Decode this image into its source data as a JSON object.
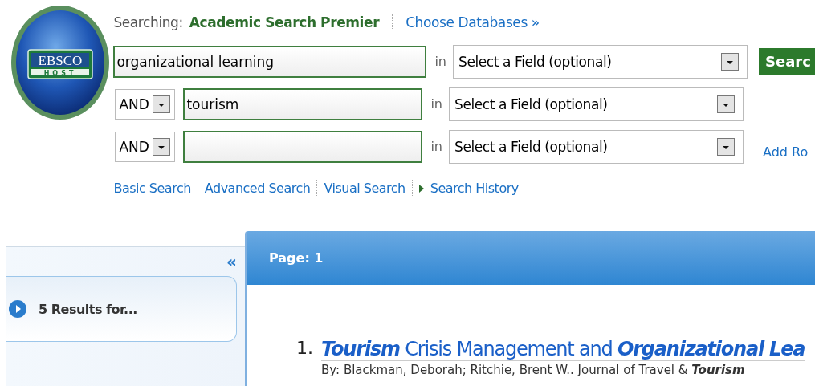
{
  "logo": {
    "top": "EBSCO",
    "bottom": "HOST"
  },
  "searching": {
    "label": "Searching:",
    "database": "Academic Search Premier",
    "choose_link": "Choose Databases »"
  },
  "search_rows": [
    {
      "operator": null,
      "value": "organizational learning",
      "in_label": "in",
      "field": "Select a Field (optional)",
      "action": {
        "kind": "button",
        "text": "Searc"
      }
    },
    {
      "operator": "AND",
      "value": "tourism",
      "in_label": "in",
      "field": "Select a Field (optional)",
      "action": null
    },
    {
      "operator": "AND",
      "value": "",
      "in_label": "in",
      "field": "Select a Field (optional)",
      "action": {
        "kind": "link",
        "text": "Add Ro"
      }
    }
  ],
  "search_links": [
    {
      "text": "Basic Search",
      "icon": false
    },
    {
      "text": "Advanced Search",
      "icon": false
    },
    {
      "text": "Visual Search",
      "icon": false
    },
    {
      "text": "Search History",
      "icon": true
    }
  ],
  "sidebar": {
    "collapse": "«",
    "results_heading": "5 Results for..."
  },
  "results": {
    "page_label": "Page: 1",
    "items": [
      {
        "number": "1.",
        "title": "**Tourism** Crisis Management and **Organizational Lea**",
        "byline": "By: Blackman, Deborah; Ritchie, Brent W.. Journal of Travel & **Tourism**"
      }
    ]
  }
}
